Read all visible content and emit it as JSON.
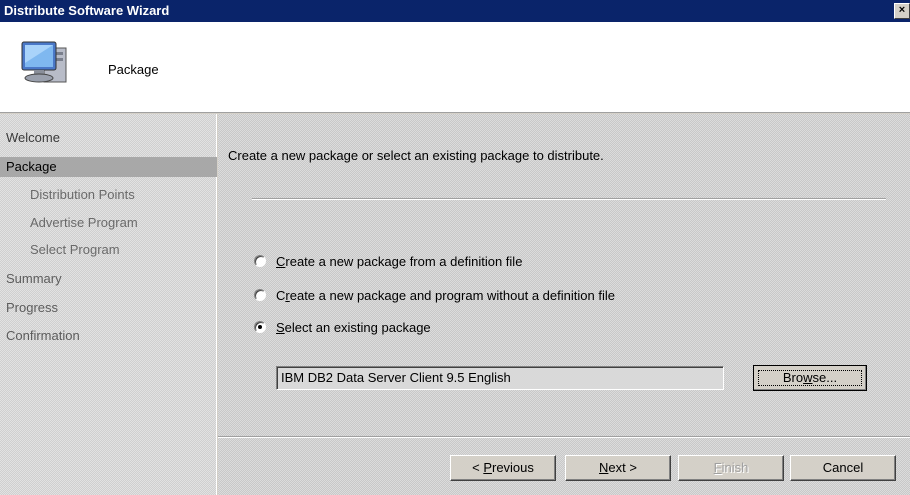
{
  "window": {
    "title": "Distribute Software Wizard",
    "close_label": "×"
  },
  "header": {
    "title": "Package",
    "icon": "computer-monitor-icon"
  },
  "sidebar": {
    "items": [
      {
        "label": "Welcome"
      },
      {
        "label": "Package",
        "active": true
      },
      {
        "label": "Distribution Points"
      },
      {
        "label": "Advertise Program"
      },
      {
        "label": "Select Program"
      },
      {
        "label": "Summary"
      },
      {
        "label": "Progress"
      },
      {
        "label": "Confirmation"
      }
    ]
  },
  "main": {
    "instruction": "Create a new package or select an existing package to distribute.",
    "options": [
      {
        "accel": "C",
        "rest": "reate a new package from a definition file",
        "selected": false
      },
      {
        "pre": "C",
        "accel": "r",
        "rest": "eate a new package and program without a definition file",
        "selected": false
      },
      {
        "accel": "S",
        "rest": "elect an existing package",
        "selected": true
      }
    ],
    "package_value": "IBM DB2 Data Server Client 9.5 English",
    "browse": {
      "pre": "Bro",
      "accel": "w",
      "rest": "se..."
    }
  },
  "footer": {
    "previous": {
      "pre": "< ",
      "accel": "P",
      "rest": "revious"
    },
    "next": {
      "accel": "N",
      "rest": "ext >"
    },
    "finish": {
      "accel": "F",
      "rest": "inish"
    },
    "cancel_label": "Cancel"
  }
}
